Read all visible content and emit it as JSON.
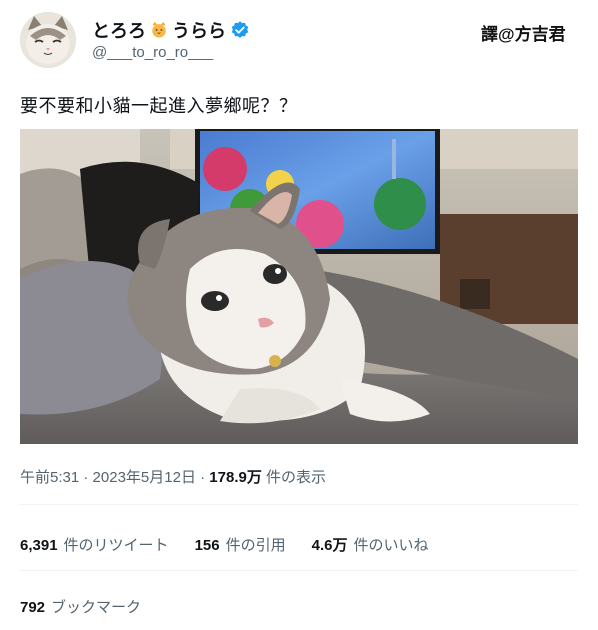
{
  "author": {
    "display_name": "とろろ",
    "display_name_suffix": "うらら",
    "handle": "@___to_ro_ro___",
    "avatar_icon": "cat-avatar",
    "verified_icon": "verified-badge-icon",
    "name_emoji": "cat-face-icon"
  },
  "watermark": "譯@方吉君",
  "tweet": {
    "text": "要不要和小貓一起進入夢鄉呢？？",
    "media": "photo of a tabby-and-white kitten lying under a grey blanket"
  },
  "meta": {
    "time": "午前5:31",
    "sep1": " · ",
    "date": "2023年5月12日",
    "sep2": " · ",
    "views_count": "178.9万",
    "views_label": "件の表示"
  },
  "stats": {
    "retweets_count": "6,391",
    "retweets_label": "件のリツイート",
    "quotes_count": "156",
    "quotes_label": "件の引用",
    "likes_count": "4.6万",
    "likes_label": "件のいいね"
  },
  "bookmarks": {
    "count": "792",
    "label": "ブックマーク"
  },
  "colors": {
    "verified": "#1d9bf0",
    "secondary_text": "#536471",
    "primary_text": "#0f1419"
  }
}
